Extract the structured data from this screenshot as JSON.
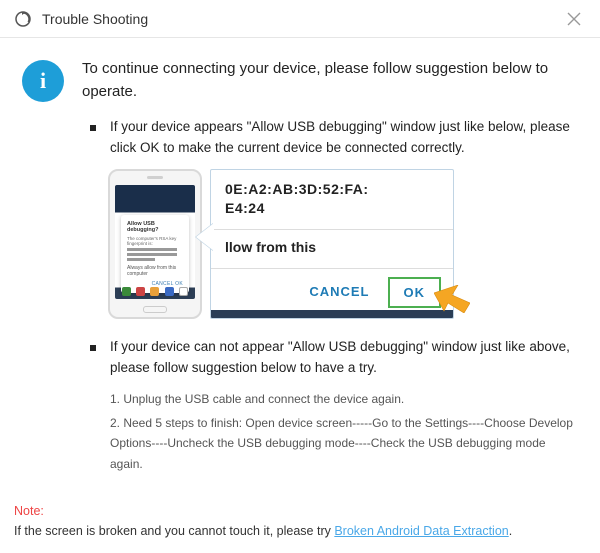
{
  "titlebar": {
    "title": "Trouble Shooting"
  },
  "lead": "To continue connecting your device, please follow suggestion below to operate.",
  "suggestions": {
    "s1": "If your device appears \"Allow USB debugging\" window just like below, please click OK to make the current device  be connected correctly.",
    "s2": "If your device can not appear \"Allow USB debugging\" window just like above, please follow suggestion below to have a try."
  },
  "callout": {
    "mac1": "0E:A2:AB:3D:52:FA:",
    "mac2": "E4:24",
    "allow_line": "llow from this",
    "cancel": "CANCEL",
    "ok": "OK"
  },
  "phone_dialog": {
    "title": "Allow USB debugging?",
    "sub": "The computer's RSA key fingerprint is:",
    "check": "Always allow from this computer",
    "actions": "CANCEL    OK"
  },
  "steps": {
    "n1": "1. Unplug the USB cable and connect the device again.",
    "n2": "2. Need 5 steps to finish: Open device screen-----Go to the Settings----Choose Develop Options----Uncheck the USB debugging mode----Check the USB debugging mode again."
  },
  "note": {
    "label": "Note:",
    "text_before": "If the screen is broken and you cannot touch it, please try ",
    "link": "Broken Android Data Extraction",
    "text_after": "."
  }
}
